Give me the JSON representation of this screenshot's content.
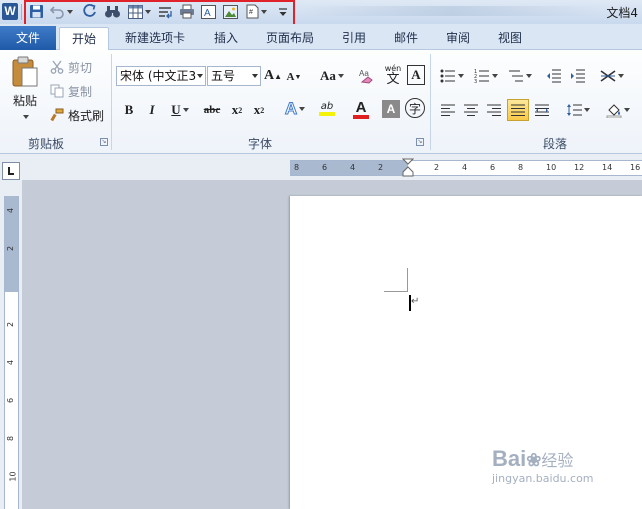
{
  "title_bar": {
    "app_icon_letter": "W",
    "document_title": "文档4"
  },
  "quick_access": {
    "icons": [
      "save-icon",
      "undo-icon",
      "redo-icon",
      "find-icon",
      "table-icon",
      "paragraph-icon",
      "print-icon",
      "text-box-icon",
      "picture-icon",
      "page-number-icon",
      "customize-icon"
    ]
  },
  "tabs": [
    {
      "label": "文件",
      "active": false
    },
    {
      "label": "开始",
      "active": true
    },
    {
      "label": "新建选项卡",
      "active": false
    },
    {
      "label": "插入",
      "active": false
    },
    {
      "label": "页面布局",
      "active": false
    },
    {
      "label": "引用",
      "active": false
    },
    {
      "label": "邮件",
      "active": false
    },
    {
      "label": "审阅",
      "active": false
    },
    {
      "label": "视图",
      "active": false
    }
  ],
  "clipboard": {
    "paste_label": "粘贴",
    "cut_label": "剪切",
    "copy_label": "复制",
    "format_painter_label": "格式刷",
    "group_label": "剪贴板"
  },
  "font": {
    "font_name": "宋体 (中文正3",
    "font_size": "五号",
    "grow_label": "A",
    "shrink_label": "A",
    "change_case_label": "Aa",
    "bold_label": "B",
    "italic_label": "I",
    "underline_label": "U",
    "strike_label": "abc",
    "subscript_label": "x",
    "subscript_sub": "2",
    "superscript_label": "x",
    "superscript_sup": "2",
    "text_effects_label": "A",
    "highlight_label": "ab",
    "font_color_label": "A",
    "shading_label": "A",
    "phonetic_label": "wén",
    "phonetic_char": "文",
    "enclose_label": "字",
    "border_label": "A",
    "clear_label": "A",
    "group_label": "字体"
  },
  "paragraph": {
    "group_label": "段落"
  },
  "ruler": {
    "h_numbers": [
      "8",
      "6",
      "4",
      "2",
      "",
      "2",
      "4",
      "6",
      "8",
      "10",
      "12",
      "14",
      "16"
    ],
    "v_numbers": [
      "4",
      "2",
      "",
      "2",
      "4",
      "6",
      "8",
      "10"
    ]
  },
  "watermark": {
    "brand": "Bai",
    "brand2": "经验",
    "url": "jingyan.baidu.com"
  },
  "colors": {
    "highlight_red": "#e0232a",
    "file_tab_blue": "#2b5797",
    "font_color_red": "#e02020",
    "highlight_yellow": "#f5f20a"
  }
}
